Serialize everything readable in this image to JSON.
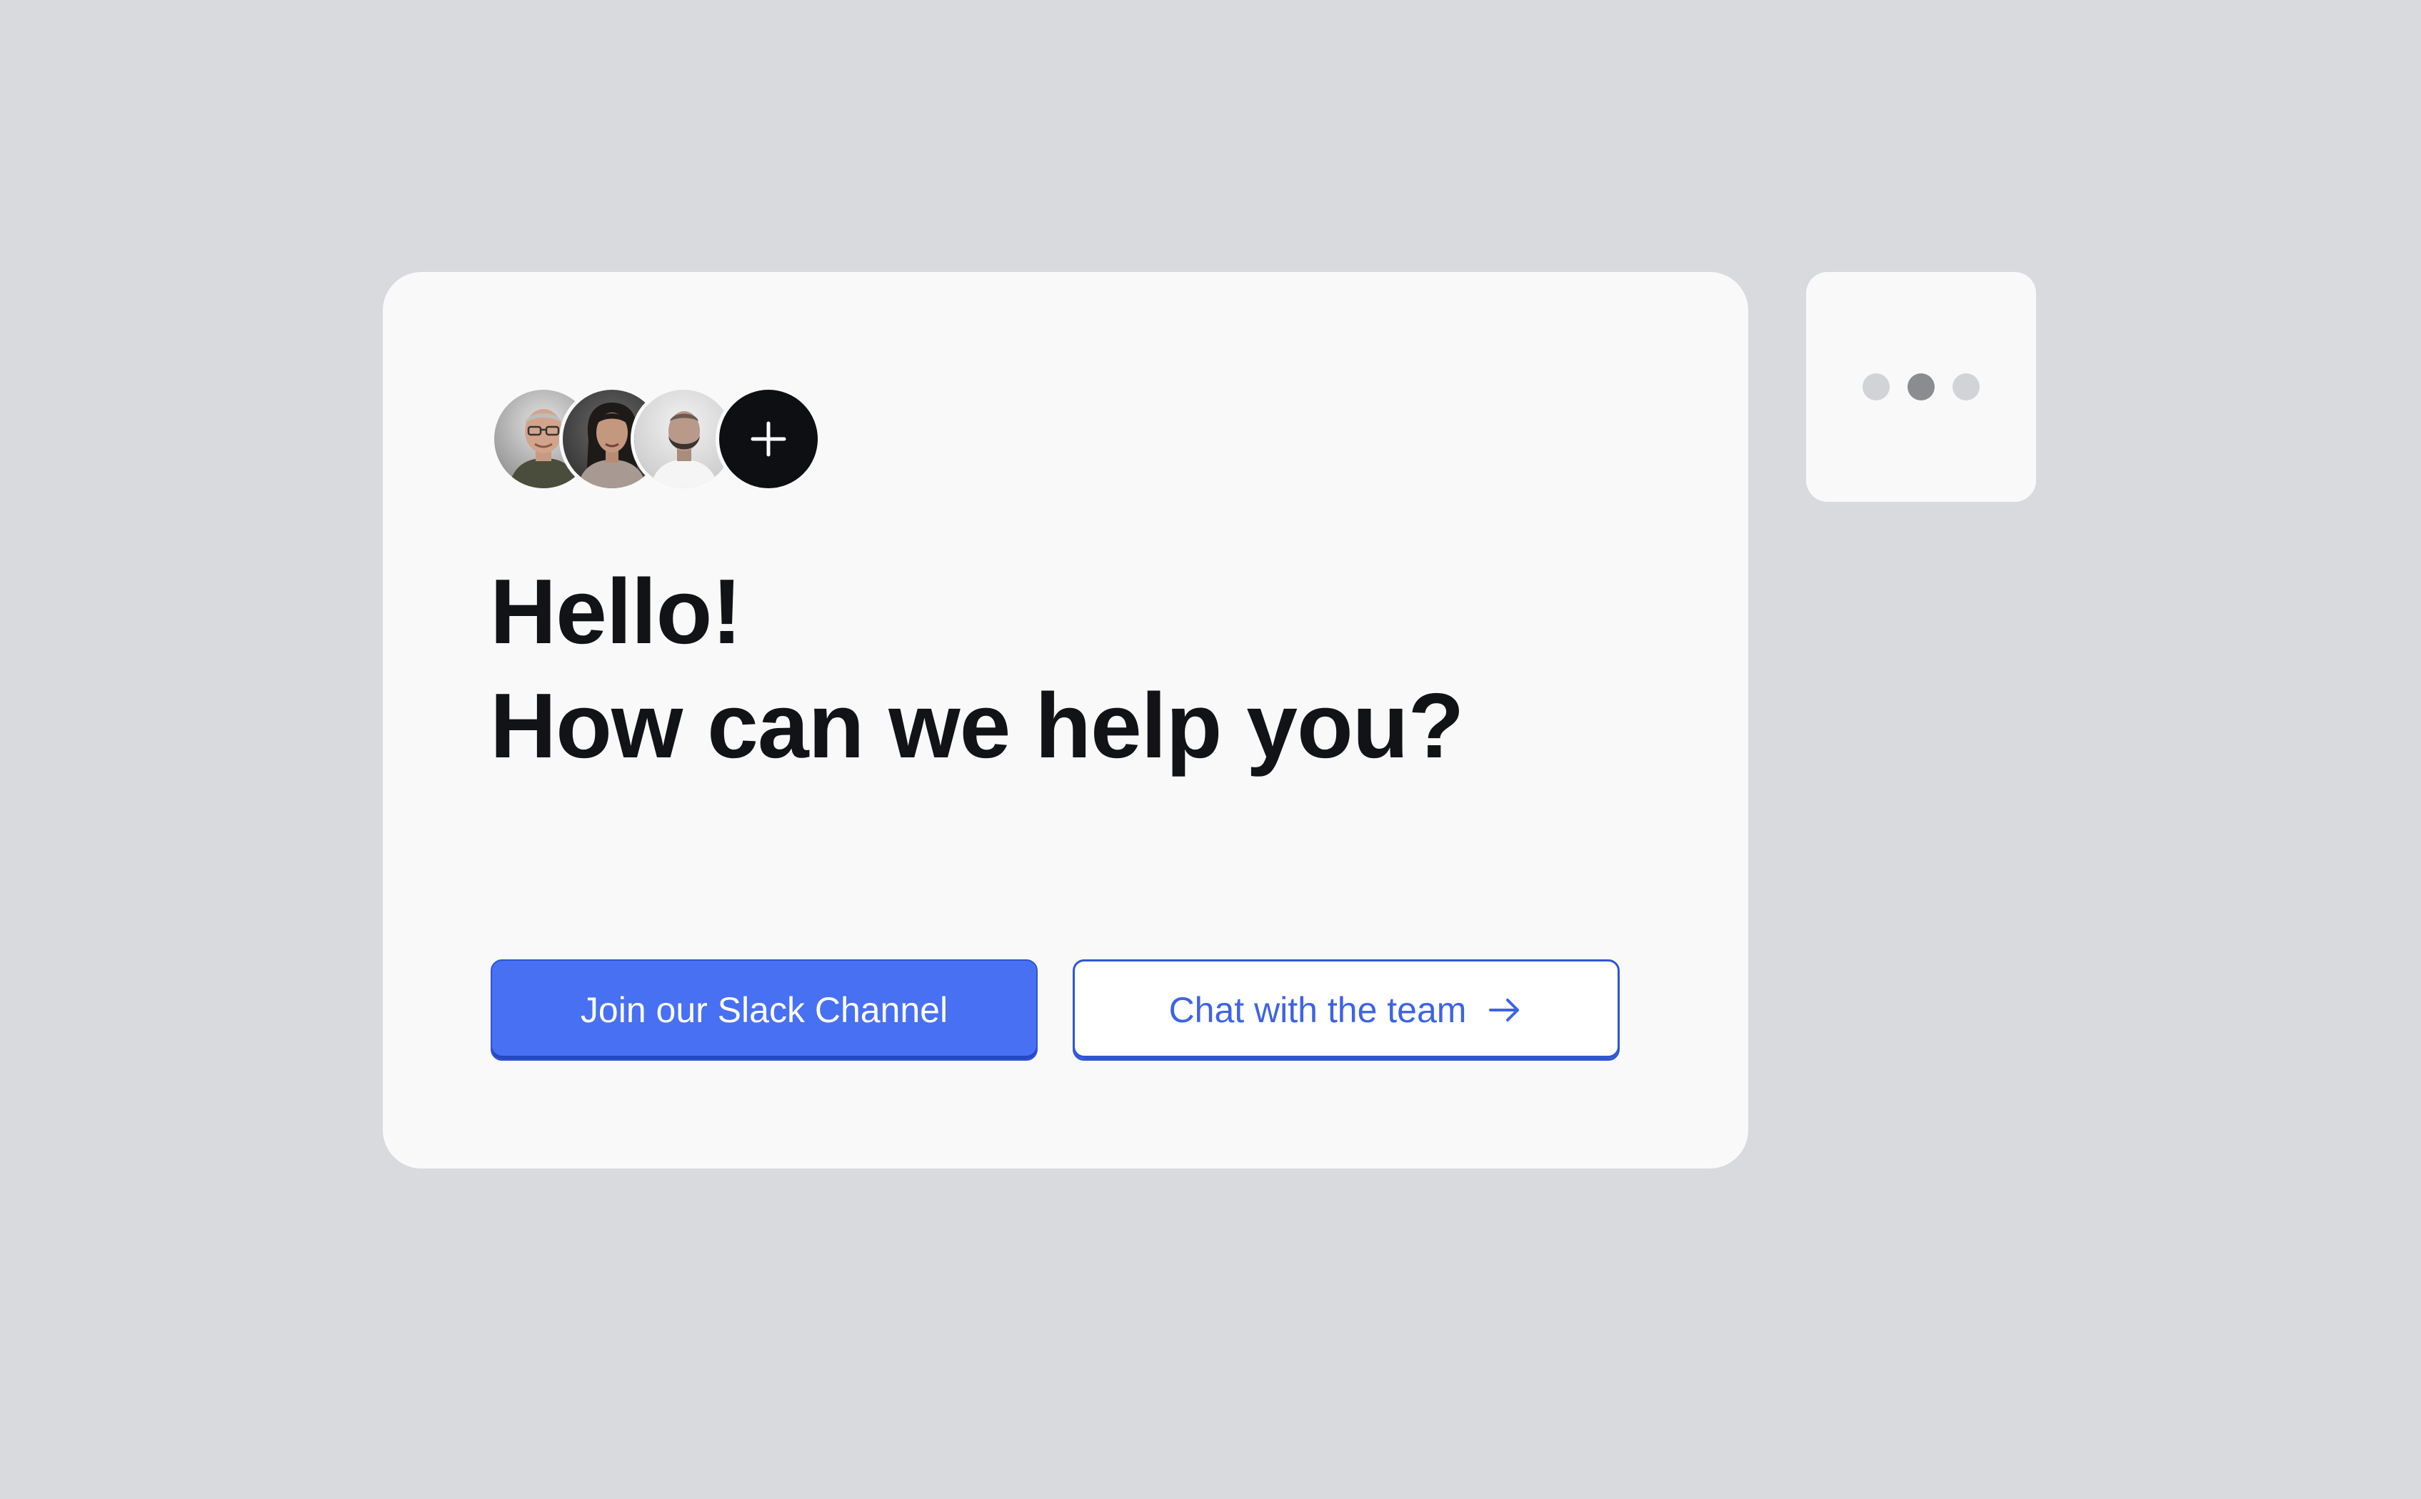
{
  "headline": {
    "line1": "Hello!",
    "line2": "How can we help you?"
  },
  "avatars": [
    {
      "name": "avatar-man-glasses"
    },
    {
      "name": "avatar-woman"
    },
    {
      "name": "avatar-man-beard"
    }
  ],
  "add_button": {
    "icon": "plus-icon"
  },
  "buttons": {
    "primary_label": "Join our Slack Channel",
    "secondary_label": "Chat with the team",
    "secondary_icon": "arrow-right-icon"
  },
  "typing_indicator": {
    "active_dot": 2,
    "dots": 3
  },
  "colors": {
    "background": "#d9dadd",
    "card": "#f9f9f9",
    "primary": "#4870f2",
    "primary_border": "#2f55d4",
    "text": "#121316",
    "add_button": "#0e0f12"
  }
}
